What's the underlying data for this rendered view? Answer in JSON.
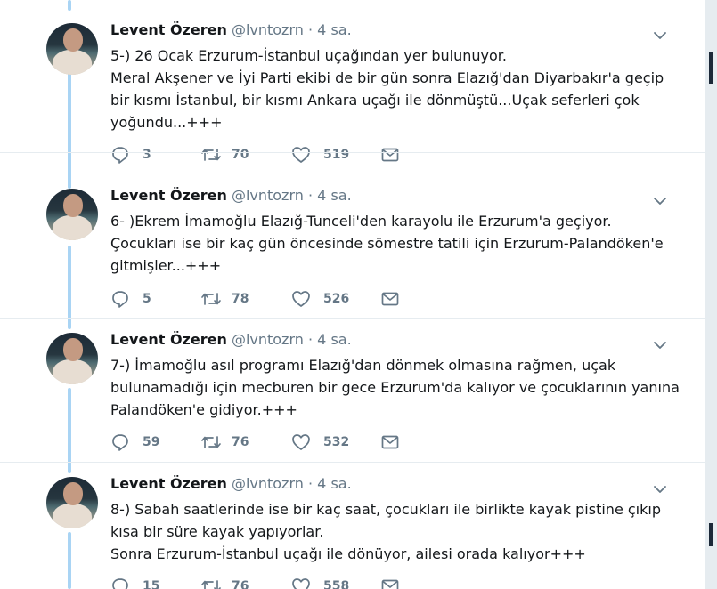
{
  "tweets": [
    {
      "name": "Levent Özeren",
      "handle": "@lvntozrn",
      "separator": "·",
      "time": "4 sa.",
      "text": "5-) 26 Ocak Erzurum-İstanbul uçağından yer bulunuyor.\nMeral Akşener ve İyi Parti ekibi de bir gün sonra Elazığ'dan Diyarbakır'a geçip bir kısmı İstanbul, bir kısmı Ankara uçağı ile dönmüştü...Uçak seferleri çok yoğundu...+++",
      "replies": "3",
      "retweets": "70",
      "likes": "519"
    },
    {
      "name": "Levent Özeren",
      "handle": "@lvntozrn",
      "separator": "·",
      "time": "4 sa.",
      "text": "6- )Ekrem İmamoğlu Elazığ-Tunceli'den karayolu ile Erzurum'a geçiyor.\nÇocukları ise bir kaç gün öncesinde sömestre tatili için Erzurum-Palandöken'e gitmişler...+++",
      "replies": "5",
      "retweets": "78",
      "likes": "526"
    },
    {
      "name": "Levent Özeren",
      "handle": "@lvntozrn",
      "separator": "·",
      "time": "4 sa.",
      "text": "7-) İmamoğlu asıl programı Elazığ'dan dönmek olmasına rağmen, uçak bulunamadığı için mecburen bir gece Erzurum'da kalıyor ve çocuklarının yanına Palandöken'e gidiyor.+++",
      "replies": "59",
      "retweets": "76",
      "likes": "532"
    },
    {
      "name": "Levent Özeren",
      "handle": "@lvntozrn",
      "separator": "·",
      "time": "4 sa.",
      "text": "8-) Sabah saatlerinde ise bir kaç saat, çocukları ile birlikte kayak pistine çıkıp kısa bir süre kayak yapıyorlar.\nSonra Erzurum-İstanbul uçağı ile dönüyor, ailesi orada kalıyor+++",
      "replies": "15",
      "retweets": "76",
      "likes": "558"
    }
  ],
  "icons": {
    "reply": "speech-bubble-icon",
    "retweet": "retweet-arrows-icon",
    "like": "heart-icon",
    "message": "envelope-icon",
    "menu": "chevron-down-icon"
  },
  "colors": {
    "thread_line": "#a9d4f4",
    "icon_gray": "#657786",
    "text": "#14171a"
  }
}
